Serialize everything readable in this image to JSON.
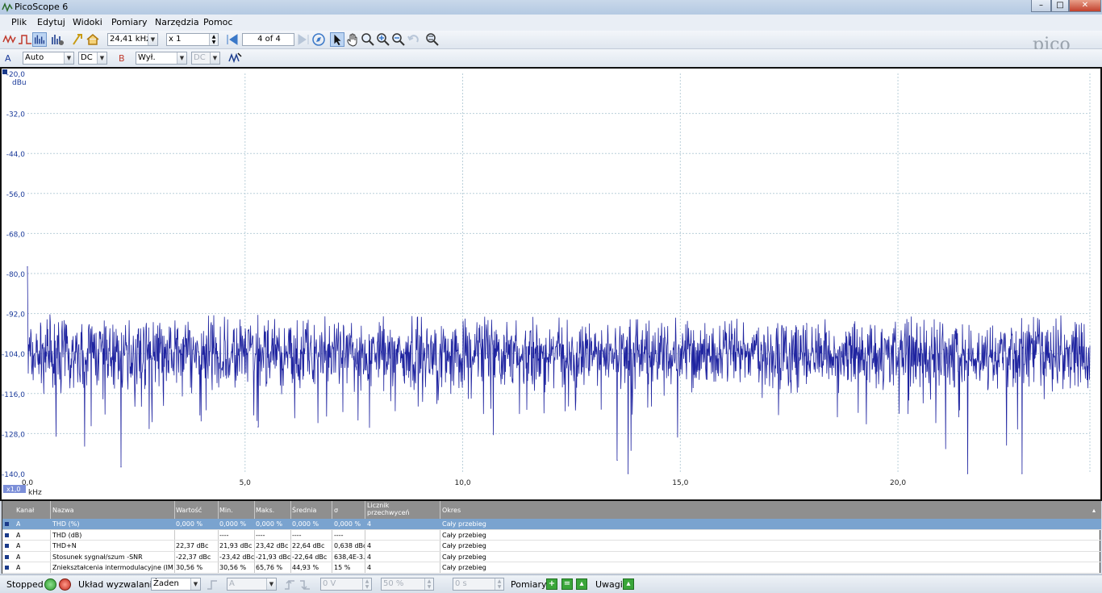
{
  "window": {
    "title": "PicoScope 6"
  },
  "menu": [
    "Plik",
    "Edytuj",
    "Widoki",
    "Pomiary",
    "Narzędzia",
    "Pomoc"
  ],
  "toolbar": {
    "frequency": "24,41 kHz",
    "multiplier": "x 1",
    "buffer": "4 of 4"
  },
  "channels": {
    "a": {
      "label": "A",
      "range": "Auto",
      "coupling": "DC"
    },
    "b": {
      "label": "B",
      "range": "Wył.",
      "coupling": "DC"
    }
  },
  "colors": {
    "trace": "#1f24a0",
    "grid": "#b9cfd9",
    "selected_row": "#7aa3cf"
  },
  "chart_data": {
    "type": "line",
    "ylabel": "dBu",
    "xlabel": "kHz",
    "scale_badge": "x1,0",
    "ylim": [
      -140,
      -20
    ],
    "xlim": [
      0,
      24.41
    ],
    "yticks": [
      "-20,0",
      "-32,0",
      "-44,0",
      "-56,0",
      "-68,0",
      "-80,0",
      "-92,0",
      "-104,0",
      "-116,0",
      "-128,0",
      "-140,0"
    ],
    "xticks": [
      "0,0",
      "5,0",
      "10,0",
      "15,0",
      "20,0"
    ],
    "grid": true,
    "series": [
      {
        "color": "#1f24a0",
        "noise_floor_db": -104,
        "noise_spread_db": 6,
        "spikes": [
          {
            "x": 0.0,
            "y": -78
          },
          {
            "x": 2.15,
            "y": -138
          },
          {
            "x": 5.3,
            "y": -126
          },
          {
            "x": 13.55,
            "y": -136
          },
          {
            "x": 13.8,
            "y": -140
          },
          {
            "x": 21.6,
            "y": -140
          },
          {
            "x": 22.85,
            "y": -140
          },
          {
            "x": 17.9,
            "y": -95
          },
          {
            "x": 20.9,
            "y": -97
          }
        ]
      }
    ]
  },
  "measurements": {
    "headers": {
      "kanal": "Kanał",
      "nazwa": "Nazwa",
      "wartosc": "Wartość",
      "min": "Min.",
      "maks": "Maks.",
      "srednia": "Średnia",
      "sigma": "σ",
      "licznik1": "Licznik",
      "licznik2": "przechwyceń",
      "okres": "Okres"
    },
    "rows": [
      {
        "kanal": "A",
        "nazwa": "THD (%)",
        "wartosc": "0,000 %",
        "min": "0,000 %",
        "maks": "0,000 %",
        "srednia": "0,000 %",
        "sigma": "0,000 %",
        "licznik": "4",
        "okres": "Cały przebieg"
      },
      {
        "kanal": "A",
        "nazwa": "THD (dB)",
        "wartosc": "",
        "min": "----",
        "maks": "----",
        "srednia": "----",
        "sigma": "----",
        "licznik": "",
        "okres": "Cały przebieg"
      },
      {
        "kanal": "A",
        "nazwa": "THD+N",
        "wartosc": "22,37 dBc",
        "min": "21,93 dBc",
        "maks": "23,42 dBc",
        "srednia": "22,64 dBc",
        "sigma": "0,638 dBc",
        "licznik": "4",
        "okres": "Cały przebieg"
      },
      {
        "kanal": "A",
        "nazwa": "Stosunek sygnał/szum -SNR",
        "wartosc": "-22,37 dBc",
        "min": "-23,42 dBc",
        "maks": "-21,93 dBc",
        "srednia": "-22,64 dBc",
        "sigma": "638,4E-3...",
        "licznik": "4",
        "okres": "Cały przebieg"
      },
      {
        "kanal": "A",
        "nazwa": "Zniekształcenia intermodulacyjne (IMD)",
        "wartosc": "30,56 %",
        "min": "30,56 %",
        "maks": "65,76 %",
        "srednia": "44,93 %",
        "sigma": "15 %",
        "licznik": "4",
        "okres": "Cały przebieg"
      }
    ]
  },
  "status": {
    "state": "Stopped",
    "trigger_label": "Układ wyzwalania",
    "trigger_mode": "Żaden",
    "trigger_channel": "A",
    "threshold": "0 V",
    "pretrigger": "50 %",
    "delay": "0 s",
    "measurements_label": "Pomiary",
    "notes_label": "Uwagi"
  }
}
